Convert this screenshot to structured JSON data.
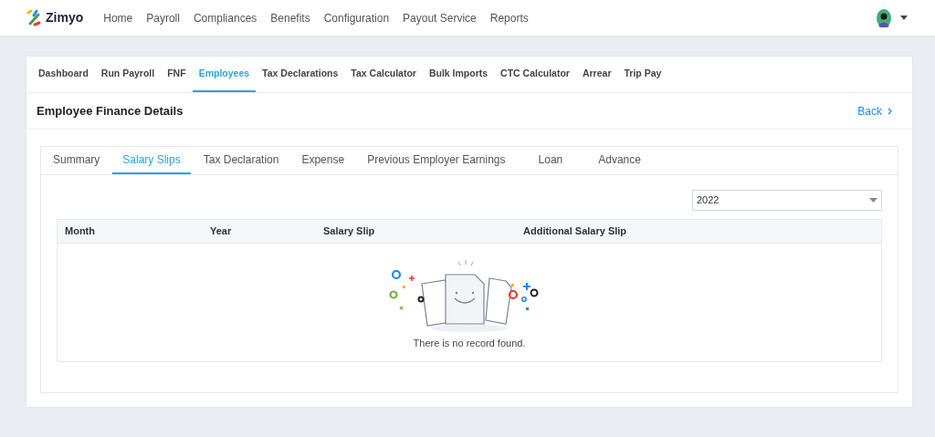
{
  "brand": "Zimyo",
  "nav": [
    "Home",
    "Payroll",
    "Compliances",
    "Benefits",
    "Configuration",
    "Payout Service",
    "Reports"
  ],
  "subnav": [
    {
      "label": "Dashboard",
      "selected": false
    },
    {
      "label": "Run Payroll",
      "selected": false
    },
    {
      "label": "FNF",
      "selected": false
    },
    {
      "label": "Employees",
      "selected": true
    },
    {
      "label": "Tax Declarations",
      "selected": false
    },
    {
      "label": "Tax Calculator",
      "selected": false
    },
    {
      "label": "Bulk Imports",
      "selected": false
    },
    {
      "label": "CTC Calculator",
      "selected": false
    },
    {
      "label": "Arrear",
      "selected": false
    },
    {
      "label": "Trip Pay",
      "selected": false
    }
  ],
  "page_title": "Employee Finance Details",
  "back": "Back",
  "tabs": [
    {
      "label": "Summary",
      "selected": false
    },
    {
      "label": "Salary Slips",
      "selected": true
    },
    {
      "label": "Tax Declaration",
      "selected": false
    },
    {
      "label": "Expense",
      "selected": false
    },
    {
      "label": "Previous Employer Earnings",
      "selected": false
    },
    {
      "label": "Loan",
      "selected": false
    },
    {
      "label": "Advance",
      "selected": false
    }
  ],
  "year_select": {
    "value": "2022"
  },
  "table": {
    "columns": [
      "Month",
      "Year",
      "Salary Slip",
      "Additional Salary Slip"
    ],
    "empty_message": "There is no record found."
  }
}
